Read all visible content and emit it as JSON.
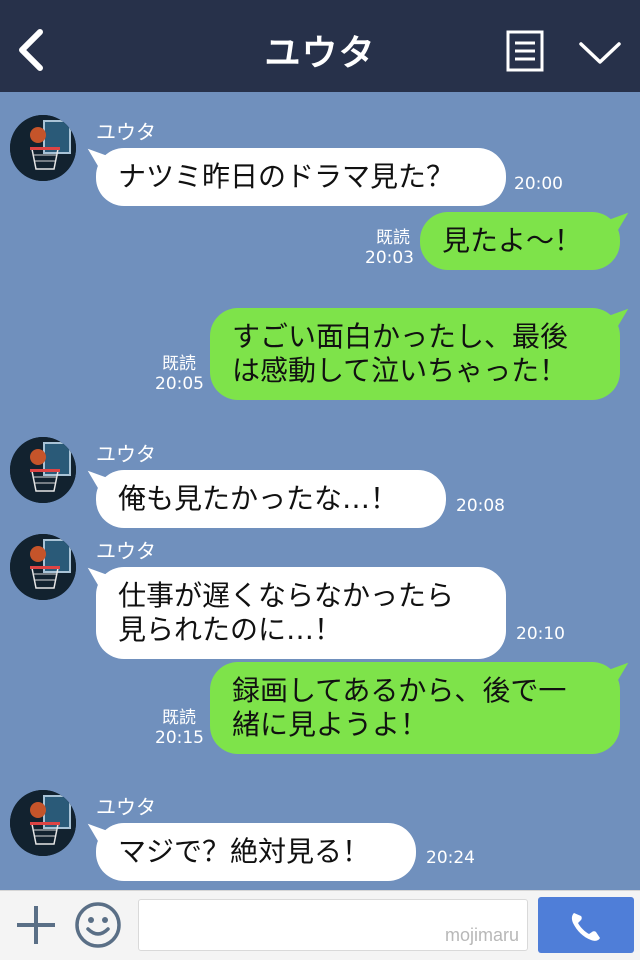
{
  "header": {
    "title": "ユウタ",
    "back_icon": "chevron-left-icon",
    "menu_icon": "menu-list-icon",
    "expand_icon": "chevron-down-icon"
  },
  "colors": {
    "header_bg": "#27314a",
    "chat_bg": "#7090bd",
    "incoming_bubble": "#ffffff",
    "outgoing_bubble": "#7ee34a",
    "send_button": "#4f7ed8"
  },
  "messages": [
    {
      "sender": "ユウタ",
      "direction": "incoming",
      "text": "ナツミ昨日のドラマ見た？",
      "time": "20:00"
    },
    {
      "direction": "outgoing",
      "read_label": "既読",
      "text": "見たよ〜！",
      "time": "20:03"
    },
    {
      "direction": "outgoing",
      "read_label": "既読",
      "text": "すごい面白かったし、最後\nは感動して泣いちゃった！",
      "time": "20:05"
    },
    {
      "sender": "ユウタ",
      "direction": "incoming",
      "text": "俺も見たかったな…！",
      "time": "20:08"
    },
    {
      "sender": "ユウタ",
      "direction": "incoming",
      "text": "仕事が遅くならなかったら\n見られたのに…！",
      "time": "20:10"
    },
    {
      "direction": "outgoing",
      "read_label": "既読",
      "text": "録画してあるから、後で一\n緒に見ようよ！",
      "time": "20:15"
    },
    {
      "sender": "ユウタ",
      "direction": "incoming",
      "text": "マジで？絶対見る！",
      "time": "20:24"
    }
  ],
  "footer": {
    "plus_icon": "plus-icon",
    "emoji_icon": "smile-icon",
    "input_value": "",
    "watermark": "mojimaru",
    "call_icon": "phone-icon"
  }
}
